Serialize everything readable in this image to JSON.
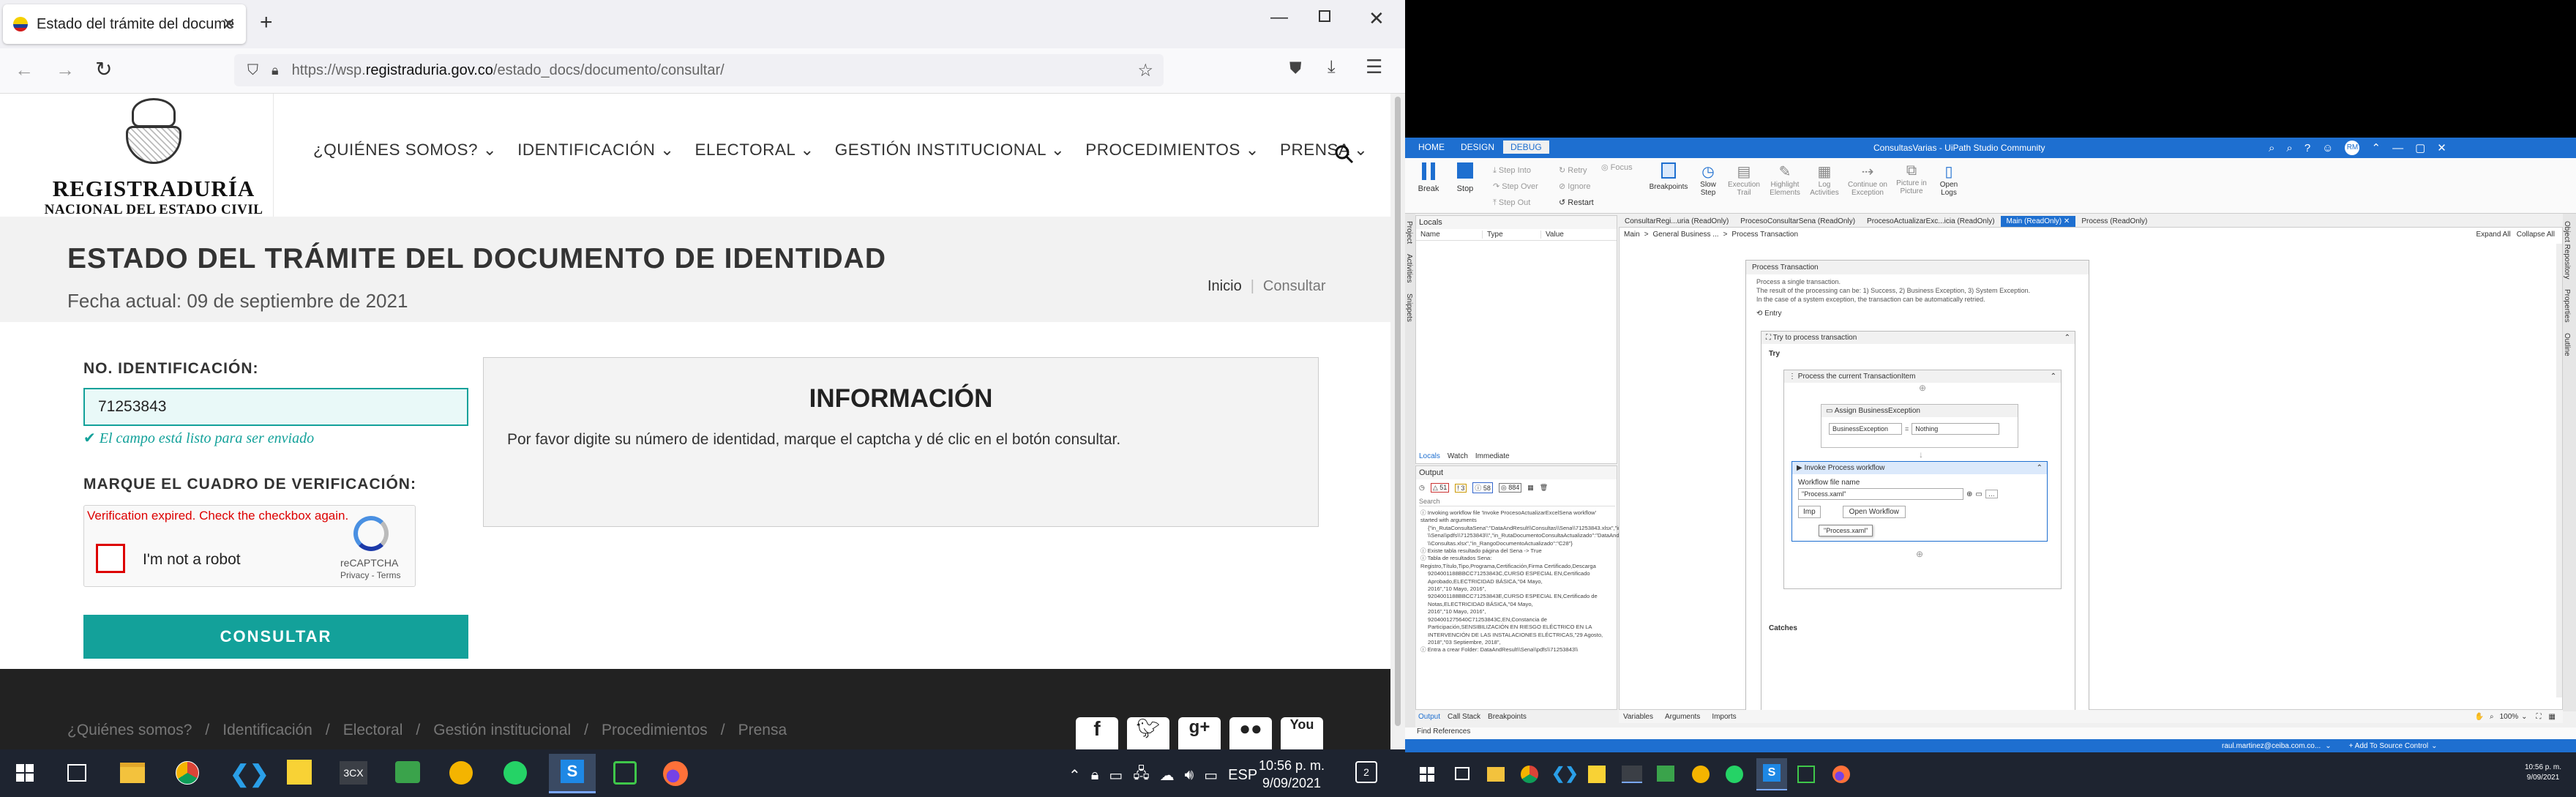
{
  "browser": {
    "tab_title": "Estado del trámite del docume",
    "url_prefix": "https://wsp.",
    "url_domain": "registraduria.gov.co",
    "url_path": "/estado_docs/documento/consultar/"
  },
  "site": {
    "logo_title": "REGISTRADURÍA",
    "logo_subtitle": "NACIONAL DEL ESTADO CIVIL",
    "nav": [
      "¿QUIÉNES SOMOS?",
      "IDENTIFICACIÓN",
      "ELECTORAL",
      "GESTIÓN INSTITUCIONAL",
      "PROCEDIMIENTOS",
      "PRENSA"
    ],
    "page_title": "ESTADO DEL TRÁMITE DEL DOCUMENTO DE IDENTIDAD",
    "date_line": "Fecha actual: 09 de septiembre de 2021",
    "breadcrumb_home": "Inicio",
    "breadcrumb_current": "Consultar",
    "id_label": "NO. IDENTIFICACIÓN:",
    "id_value": "71253843",
    "valid_msg": "El campo está listo para ser enviado",
    "captcha_label": "MARQUE EL CUADRO DE VERIFICACIÓN:",
    "captcha_error": "Verification expired. Check the checkbox again.",
    "captcha_text": "I'm not a robot",
    "recaptcha": "reCAPTCHA",
    "recaptcha_links": "Privacy - Terms",
    "submit": "CONSULTAR",
    "info_title": "INFORMACIÓN",
    "info_text": "Por favor digite su número de identidad, marque el captcha y dé clic en el botón consultar.",
    "footer_links": [
      "¿Quiénes somos?",
      "Identificación",
      "Electoral",
      "Gestión institucional",
      "Procedimientos",
      "Prensa"
    ]
  },
  "taskbar_left": {
    "lang": "ESP",
    "time": "10:56 p. m.",
    "date": "9/09/2021",
    "notif": "2"
  },
  "studio": {
    "title": "ConsultasVarias - UiPath Studio Community",
    "ribbon_tabs": [
      "HOME",
      "DESIGN",
      "DEBUG"
    ],
    "ribbon": {
      "break": "Break",
      "stop": "Stop",
      "step_into": "Step Into",
      "step_over": "Step Over",
      "step_out": "Step Out",
      "retry": "Retry",
      "ignore": "Ignore",
      "restart": "Restart",
      "focus": "Focus",
      "breakpoints": "Breakpoints",
      "slow_step": "Slow Step",
      "exec_trail": "Execution Trail",
      "highlight": "Highlight Elements",
      "log_act": "Log Activities",
      "continue_exc": "Continue on Exception",
      "pip": "Picture in Picture",
      "open_logs": "Open Logs"
    },
    "left_side_tabs": [
      "Project",
      "Activities",
      "Snippets"
    ],
    "right_side_tabs": [
      "Object Repository",
      "Properties",
      "Outline"
    ],
    "locals_title": "Locals",
    "locals_cols": [
      "Name",
      "Type",
      "Value"
    ],
    "locals_tabs": [
      "Locals",
      "Watch",
      "Immediate"
    ],
    "output_title": "Output",
    "output_counts": [
      "51",
      "3",
      "58",
      "884"
    ],
    "search_placeholder": "Search",
    "output_lines": [
      "Invoking workflow file 'Invoke ProcesoActualizarExcelSena workflow' started with arguments",
      "{\"in_RutaConsultaSena\":\"DataAndResult\\\\Consultas\\\\Sena\\\\71253843.xlsx\",\"in_RutaPDFSena\":\"DataAndResult",
      "\\\\Sena\\\\pdfs\\\\71253843\\\\\",\"in_RutaDocumentoConsultaActualizado\":\"DataAndResult\\\\Resultado\\\\",
      "\\\\Consultas.xlsx\",\"in_RangoDocumentoActualizado\":\"C28\"}",
      "Existe tabla resultado página del Sena -> True",
      "Tabla de resultados Sena: Registro,Título,Tipo,Programa,Certificación,Firma Certificado,Descarga",
      "9204001188BBCC71253843C,CURSO ESPECIAL EN,Certificado Aprobado,ELECTRICIDAD BÁSICA,\"04 Mayo,",
      "2016\",\"10 Mayo, 2016\",",
      "9204001188BBCC71253843E,CURSO ESPECIAL EN,Certificado de Notas,ELECTRICIDAD BÁSICA,\"04 Mayo,",
      "2016\",\"10 Mayo, 2016\",",
      "9204001275640C71253843C,EN,Constancia de Participación,SENSIBILIZACIÓN EN RIESGO ELÉCTRICO EN LA",
      "INTERVENCIÓN DE LAS INSTALACIONES ELÉCTRICAS,\"29 Agosto, 2018\",\"03 Septiembre, 2018\",",
      "Entra a crear Folder: DataAndResult\\\\Sena\\\\pdfs\\\\71253843\\\\"
    ],
    "output_tabs": [
      "Output",
      "Call Stack",
      "Breakpoints"
    ],
    "doc_tabs": [
      "ConsultarRegi...uria (ReadOnly)",
      "ProcesoConsultarSena (ReadOnly)",
      "ProcesoActualizarExc...icia (ReadOnly)",
      "Main (ReadOnly)",
      "Process (ReadOnly)"
    ],
    "breadcrumb": [
      "Main",
      "General Business ...",
      "Process Transaction"
    ],
    "expand_all": "Expand All",
    "collapse_all": "Collapse All",
    "process_title": "Process Transaction",
    "process_desc": [
      "Process a single transaction.",
      "The result of the processing can be: 1) Success, 2) Business Exception, 3) System Exception.",
      "In the case of a system exception, the transaction can be automatically retried."
    ],
    "entry": "Entry",
    "try_title": "Try to process transaction",
    "try_label": "Try",
    "process_item": "Process the current TransactionItem",
    "assign_title": "Assign BusinessException",
    "assign_left": "BusinessException",
    "assign_eq": "=",
    "assign_right": "Nothing",
    "invoke_title": "Invoke Process workflow",
    "wf_label": "Workflow file name",
    "wf_value": "\"Process.xaml\"",
    "tooltip": "\"Process.xaml\"",
    "import_btn": "Imp",
    "open_wf": "Open Workflow",
    "catches": "Catches",
    "bottom_tabs": [
      "Variables",
      "Arguments",
      "Imports"
    ],
    "zoom": "100%",
    "find_refs": "Find References",
    "status_user": "raul.martinez@ceiba.com.co...",
    "status_source": "+ Add To Source Control",
    "time": "10:56 p. m.",
    "date": "9/09/2021",
    "user_initials": "RM"
  },
  "colors": {
    "teal": "#13a19a",
    "studio_blue": "#1e6fd0",
    "dark": "#2d2d2d"
  }
}
